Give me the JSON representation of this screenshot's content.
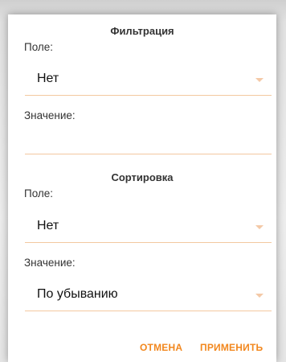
{
  "filter": {
    "title": "Фильтрация",
    "field_label": "Поле:",
    "field_value": "Нет",
    "value_label": "Значение:",
    "value_input": ""
  },
  "sort": {
    "title": "Сортировка",
    "field_label": "Поле:",
    "field_value": "Нет",
    "value_label": "Значение:",
    "value_value": "По убыванию"
  },
  "actions": {
    "cancel": "ОТМЕНА",
    "apply": "ПРИМЕНИТЬ"
  },
  "colors": {
    "accent": "#f2871d",
    "underline": "#f3c8a0"
  },
  "icons": {
    "dropdown": "chevron-down-icon"
  }
}
